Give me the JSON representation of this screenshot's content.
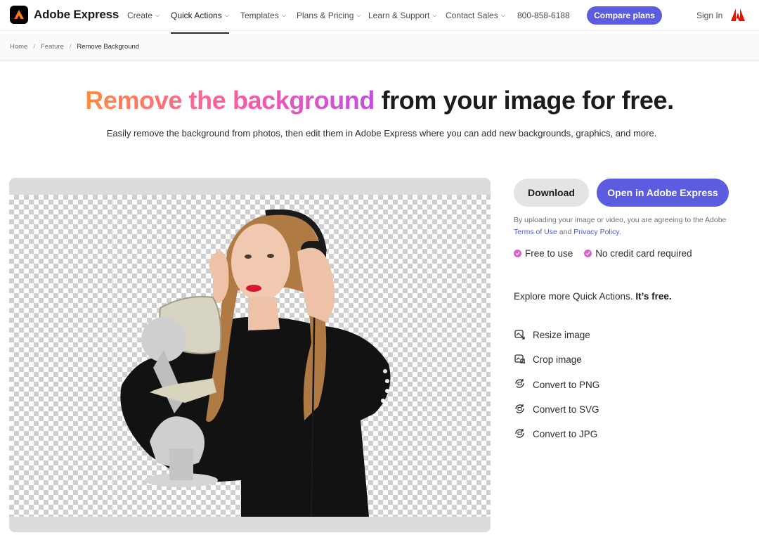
{
  "brand": {
    "name": "Adobe Express"
  },
  "nav": {
    "items": [
      {
        "label": "Create"
      },
      {
        "label": "Quick Actions"
      },
      {
        "label": "Templates"
      },
      {
        "label": "Plans & Pricing"
      },
      {
        "label": "Learn & Support"
      },
      {
        "label": "Contact Sales"
      }
    ],
    "phone": "800-858-6188",
    "compare_label": "Compare plans",
    "signin_label": "Sign In"
  },
  "breadcrumb": [
    "Home",
    "Feature",
    "Remove Background"
  ],
  "hero": {
    "headline_highlight": "Remove the background",
    "headline_rest": " from your image for free.",
    "subhead": "Easily remove the background from photos, then edit them in Adobe Express where you can add new backgrounds, graphics, and more."
  },
  "actions": {
    "download_label": "Download",
    "open_label": "Open in Adobe Express"
  },
  "legal": {
    "prefix": "By uploading your image or video, you are agreeing to the Adobe",
    "terms": "Terms of Use",
    "and": "and",
    "privacy": "Privacy Policy",
    "suffix": "."
  },
  "perks": [
    "Free to use",
    "No credit card required"
  ],
  "explore": {
    "text": "Explore more Quick Actions.",
    "bold": "It’s free."
  },
  "quick_actions": [
    {
      "label": "Resize image",
      "icon": "resize-icon"
    },
    {
      "label": "Crop image",
      "icon": "crop-icon"
    },
    {
      "label": "Convert to PNG",
      "icon": "convert-icon"
    },
    {
      "label": "Convert to SVG",
      "icon": "convert-icon"
    },
    {
      "label": "Convert to JPG",
      "icon": "convert-icon"
    }
  ],
  "colors": {
    "accent": "#5c5ce0",
    "check": "#e05bd6",
    "link": "#4a5bd8"
  }
}
